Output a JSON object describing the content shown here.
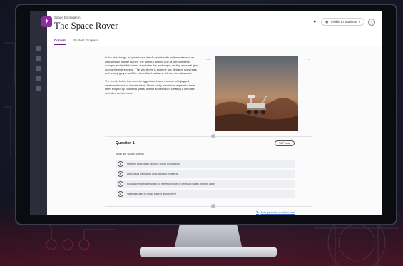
{
  "header": {
    "breadcrumb": "Space Exploration",
    "title": "The Space Rover",
    "visibility_label": "Visible to students",
    "course_icon": "course-icon"
  },
  "tabs": [
    {
      "label": "Content",
      "active": true
    },
    {
      "label": "Student Progress",
      "active": false
    }
  ],
  "passage": {
    "paragraph_1": "In the vivid image, a space rover stands prominently on the surface of an otherworldly orange planet. The planet's distinct hue, a blend of deep oranges and reddish tones, dominates the landscape, casting a surreal glow across the entire scene. The sky above is an eerie mix of warm, rusty hues and smoky grays, as if the planet itself is aflame with an eternal sunset.",
    "paragraph_2": "The terrain below the rover is rugged and barren, strewn with jagged, weathered rocks of various sizes. These rocky formations appear to have been shaped by countless years of wind and erosion, creating a desolate and alien environment."
  },
  "question": {
    "title": "Question 1",
    "points": "10 Points",
    "prompt": "What are space rovers?",
    "options": [
      {
        "letter": "A",
        "text": "Manned spacecraft used for space exploration"
      },
      {
        "letter": "B",
        "text": "Astronauts trained for long-duration missions"
      },
      {
        "letter": "C",
        "text": "Robotic vehicles designed for the exploration of celestial bodies beyond Earth"
      },
      {
        "letter": "D",
        "text": "Satellites used to study Earth's atmosphere"
      }
    ]
  },
  "footer": {
    "auto_generate_label": "Auto-generate question bank"
  },
  "more_menu_glyph": "···",
  "colors": {
    "accent": "#6a1b7e",
    "link": "#3f6fb6",
    "nav": "#2b2d3a"
  }
}
